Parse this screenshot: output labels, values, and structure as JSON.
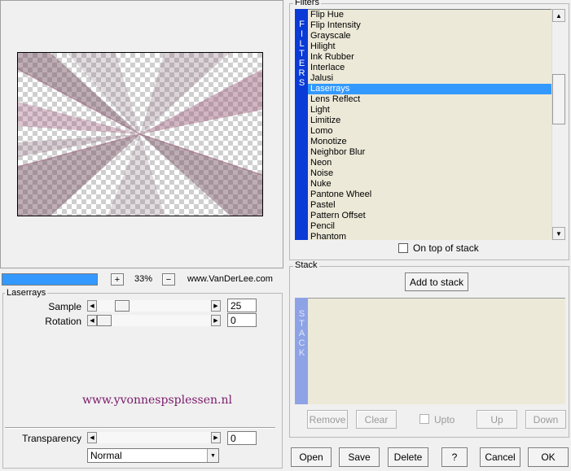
{
  "preview": {
    "zoom": "33%",
    "zoom_in": "+",
    "zoom_out": "−",
    "credit": "www.VanDerLee.com",
    "progress": 1.0
  },
  "params": {
    "group_title": "Laserrays",
    "sliders": [
      {
        "label": "Sample",
        "value": "25",
        "position": 0.18
      },
      {
        "label": "Rotation",
        "value": "0",
        "position": 0.0
      }
    ],
    "watermark": "www.yvonnespsplessen.nl",
    "transparency_label": "Transparency",
    "transparency_value": "0",
    "blend_mode": "Normal"
  },
  "filters": {
    "group_title": "Filters",
    "tab_label": "FILTERS",
    "items": [
      "Flip Hue",
      "Flip Intensity",
      "Grayscale",
      "Hilight",
      "Ink Rubber",
      "Interlace",
      "Jalusi",
      "Laserrays",
      "Lens Reflect",
      "Light",
      "Limitize",
      "Lomo",
      "Monotize",
      "Neighbor Blur",
      "Neon",
      "Noise",
      "Nuke",
      "Pantone Wheel",
      "Pastel",
      "Pattern Offset",
      "Pencil",
      "Phantom"
    ],
    "selected": "Laserrays",
    "scroll_up": "▲",
    "scroll_down": "▼",
    "on_top_label": "On top of stack",
    "on_top_checked": false
  },
  "stack": {
    "group_title": "Stack",
    "add_label": "Add to stack",
    "tab_label": "STACK",
    "remove": "Remove",
    "clear": "Clear",
    "upto": "Upto",
    "up": "Up",
    "down": "Down"
  },
  "footer": {
    "open": "Open",
    "save": "Save",
    "delete": "Delete",
    "help": "?",
    "cancel": "Cancel",
    "ok": "OK"
  },
  "colors": {
    "accent": "#3399ff",
    "tab_blue": "#0b3bd6",
    "list_bg": "#ece9d8",
    "watermark": "#7a1a6a",
    "ray": "#9b5a78"
  }
}
